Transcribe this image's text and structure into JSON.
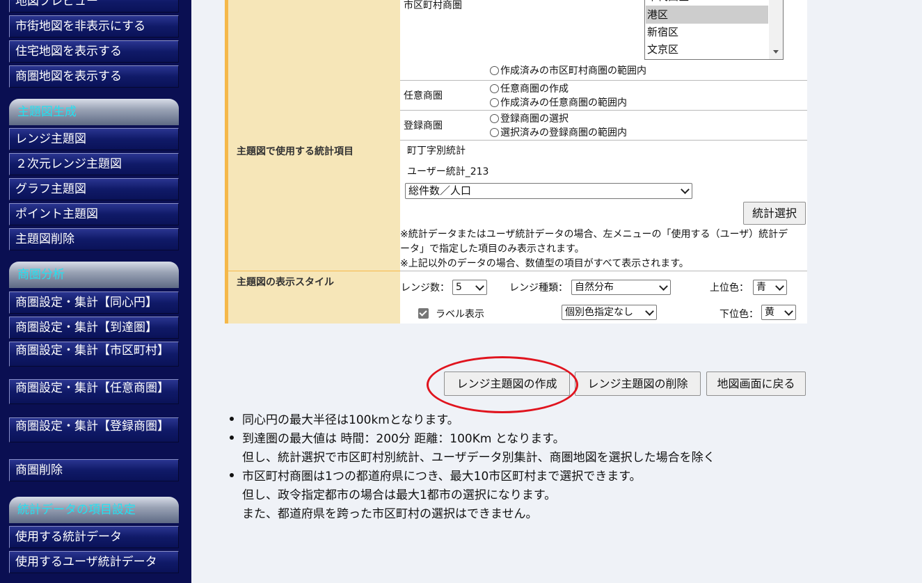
{
  "sidebar": {
    "top_items": [
      "地図プレビュー",
      "市街地図を非表示にする",
      "住宅地図を表示する",
      "商圏地図を表示する"
    ],
    "section_theme": {
      "title": "主題図生成",
      "items": [
        "レンジ主題図",
        "２次元レンジ主題図",
        "グラフ主題図",
        "ポイント主題図",
        "主題図削除"
      ]
    },
    "section_area": {
      "title": "商圏分析",
      "items": [
        "商圏設定・集計【同心円】",
        "商圏設定・集計【到達圏】",
        "商圏設定・集計【市区町村】",
        "商圏設定・集計【任意商圏】",
        "商圏設定・集計【登録商圏】",
        "商圏削除"
      ]
    },
    "section_stats": {
      "title": "統計データの項目設定",
      "items": [
        "使用する統計データ",
        "使用するユーザ統計データ"
      ]
    }
  },
  "form": {
    "municipal": {
      "label": "市区町村商圏",
      "list_options": [
        "千代田区",
        "港区",
        "新宿区",
        "文京区"
      ],
      "selected": "港区",
      "radio_in_created": "作成済みの市区町村商圏の範囲内"
    },
    "custom": {
      "label": "任意商圏",
      "radio_create": "任意商圏の作成",
      "radio_in_created": "作成済みの任意商圏の範囲内"
    },
    "registered": {
      "label": "登録商圏",
      "radio_select": "登録商圏の選択",
      "radio_in_selected": "選択済みの登録商圏の範囲内"
    },
    "stats": {
      "label": "主題図で使用する統計項目",
      "source1": "町丁字別統計",
      "source2": "ユーザー統計_213",
      "item_select": "総件数／人口",
      "select_button": "統計選択",
      "note1a": "※統計データまたはユーザ統計データの場合、左メニューの「使用する（ユーザ）統計デ",
      "note1b": "ータ」で指定した項目のみ表示されます。",
      "note2": "※上記以外のデータの場合、数値型の項目がすべて表示されます。"
    },
    "style": {
      "label": "主題図の表示スタイル",
      "range_count_label": "レンジ数：",
      "range_count": "5",
      "range_type_label": "レンジ種類：",
      "range_type": "自然分布",
      "upper_color_label": "上位色：",
      "upper_color": "青",
      "show_label": "ラベル表示",
      "color_option": "個別色指定なし",
      "lower_color_label": "下位色：",
      "lower_color": "黄"
    }
  },
  "actions": {
    "create": "レンジ主題図の作成",
    "delete": "レンジ主題図の削除",
    "back": "地図画面に戻る"
  },
  "notes": {
    "n1": "同心円の最大半径は100kmとなります。",
    "n2a": "到達圏の最大値は 時間：200分 距離：100Km となります。",
    "n2b": "但し、統計選択で市区町村別統計、ユーザデータ別集計、商圏地図を選択した場合を除く",
    "n3a": "市区町村商圏は1つの都道府県につき、最大10市区町村まで選択できます。",
    "n3b": "但し、政令指定都市の場合は最大1都市の選択になります。",
    "n3c": "また、都道府県を跨った市区町村の選択はできません。"
  },
  "colors": {
    "sidebar_bg": "#0a0f52",
    "section_title": "#24e0f0",
    "label_bg": "#f6e6b8",
    "label_border": "#f5b84a",
    "highlight_ring": "#e0141e"
  }
}
